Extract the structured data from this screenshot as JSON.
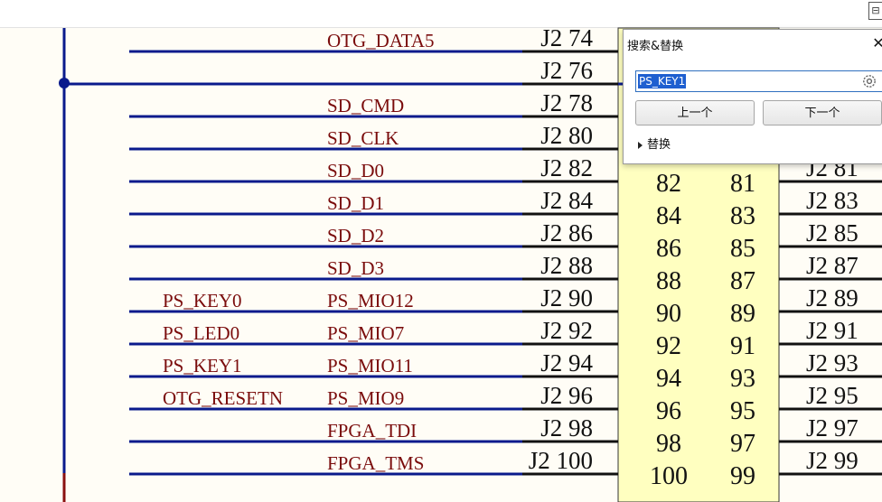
{
  "signals": [
    {
      "net": "",
      "label": "OTG_DATA5",
      "pin": "J2 74"
    },
    {
      "net": "",
      "label": "",
      "pin": "J2 76"
    },
    {
      "net": "",
      "label": "SD_CMD",
      "pin": "J2 78"
    },
    {
      "net": "",
      "label": "SD_CLK",
      "pin": "J2 80"
    },
    {
      "net": "",
      "label": "SD_D0",
      "pin": "J2 82"
    },
    {
      "net": "",
      "label": "SD_D1",
      "pin": "J2 84"
    },
    {
      "net": "",
      "label": "SD_D2",
      "pin": "J2 86"
    },
    {
      "net": "",
      "label": "SD_D3",
      "pin": "J2 88"
    },
    {
      "net": "PS_KEY0",
      "label": "PS_MIO12",
      "pin": "J2 90"
    },
    {
      "net": "PS_LED0",
      "label": "PS_MIO7",
      "pin": "J2 92"
    },
    {
      "net": "PS_KEY1",
      "label": "PS_MIO11",
      "pin": "J2 94"
    },
    {
      "net": "OTG_RESETN",
      "label": "PS_MIO9",
      "pin": "J2 96"
    },
    {
      "net": "",
      "label": "FPGA_TDI",
      "pin": "J2 98"
    },
    {
      "net": "",
      "label": "FPGA_TMS",
      "pin": "J2 100"
    }
  ],
  "connector_rows": [
    {
      "even": "82",
      "odd": "81"
    },
    {
      "even": "84",
      "odd": "83"
    },
    {
      "even": "86",
      "odd": "85"
    },
    {
      "even": "88",
      "odd": "87"
    },
    {
      "even": "90",
      "odd": "89"
    },
    {
      "even": "92",
      "odd": "91"
    },
    {
      "even": "94",
      "odd": "93"
    },
    {
      "even": "96",
      "odd": "95"
    },
    {
      "even": "98",
      "odd": "97"
    },
    {
      "even": "100",
      "odd": "99"
    }
  ],
  "right_pins": [
    "J2 81",
    "J2 83",
    "J2 85",
    "J2 87",
    "J2 89",
    "J2 91",
    "J2 93",
    "J2 95",
    "J2 97",
    "J2 99"
  ],
  "find_dialog": {
    "title": "搜索&替换",
    "close_symbol": "✕",
    "search_value": "PS_KEY1",
    "prev_label": "上一个",
    "next_label": "下一个",
    "replace_label": "替换"
  },
  "colors": {
    "wire": "#0a1a8c",
    "signal_text": "#7a0c0c",
    "connector_fill": "#ffffc0",
    "background": "#fffdf6"
  },
  "toolbar_icon": "window-icon"
}
